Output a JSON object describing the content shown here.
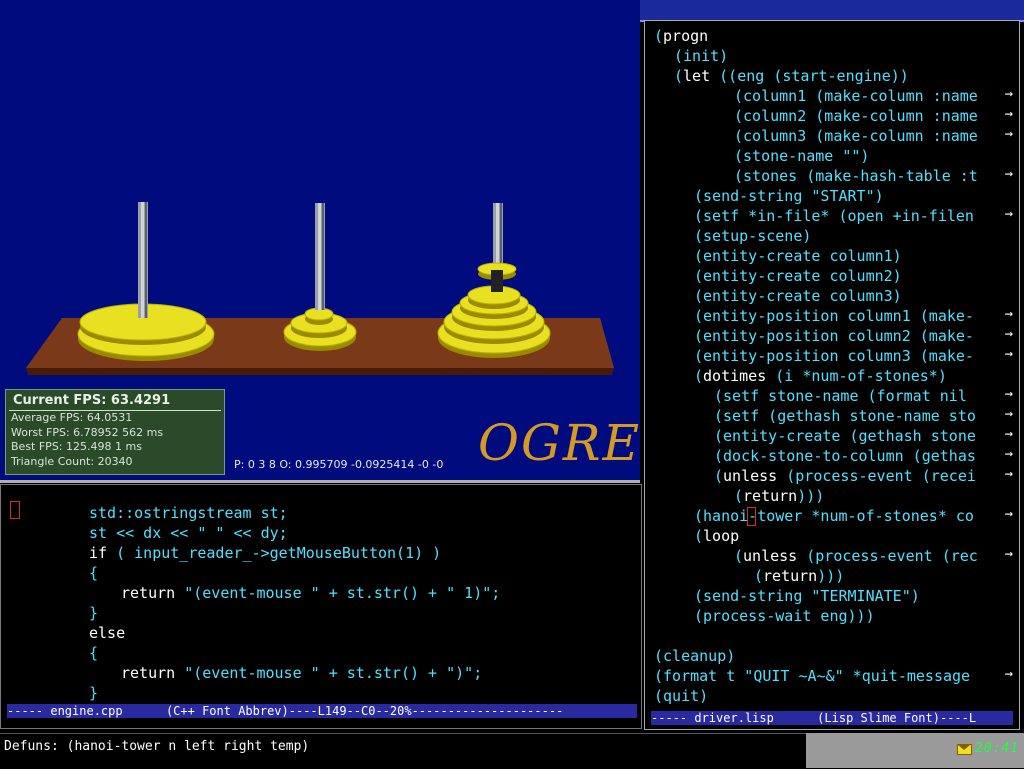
{
  "viewport": {
    "fps": {
      "current": "Current FPS: 63.4291",
      "average": "Average FPS: 64.0531",
      "worst": "Worst FPS: 6.78952 562 ms",
      "best": "Best FPS: 125.498 1 ms",
      "triangles": "Triangle Count: 20340"
    },
    "logo": "OGRE",
    "position_readout": "P: 0 3 8 O: 0.995709 -0.0925414 -0 -0",
    "colors": {
      "background": "#000c7e",
      "board": "#7a3a1a",
      "stone": "#e8e020",
      "peg": "#9aa0a6"
    }
  },
  "cpp_editor": {
    "lines": [
      {
        "indent": 5,
        "parts": [
          {
            "t": "std::ostringstream st;",
            "k": false
          }
        ]
      },
      {
        "indent": 5,
        "parts": [
          {
            "t": "st << dx << \" \" << dy;",
            "k": false
          }
        ]
      },
      {
        "indent": 5,
        "parts": [
          {
            "t": "if",
            "k": true
          },
          {
            "t": " ( input_reader_->getMouseButton(1) )",
            "k": false
          }
        ]
      },
      {
        "indent": 5,
        "parts": [
          {
            "t": "{",
            "k": false
          }
        ]
      },
      {
        "indent": 7,
        "parts": [
          {
            "t": "return",
            "k": true
          },
          {
            "t": " \"(event-mouse \" + st.str() + \" 1)\";",
            "k": false
          }
        ]
      },
      {
        "indent": 5,
        "parts": [
          {
            "t": "}",
            "k": false
          }
        ]
      },
      {
        "indent": 5,
        "parts": [
          {
            "t": "else",
            "k": true
          }
        ]
      },
      {
        "indent": 5,
        "parts": [
          {
            "t": "{",
            "k": false
          }
        ]
      },
      {
        "indent": 7,
        "parts": [
          {
            "t": "return",
            "k": true
          },
          {
            "t": " \"(event-mouse \" + st.str() + \")\";",
            "k": false
          }
        ]
      },
      {
        "indent": 5,
        "parts": [
          {
            "t": "}",
            "k": false
          }
        ]
      }
    ],
    "modeline": "----- engine.cpp      (C++ Font Abbrev)----L149--C0--20%---------------------"
  },
  "lisp_editor": {
    "lines": [
      {
        "indent": 0,
        "parts": [
          {
            "t": "(",
            "k": false
          },
          {
            "t": "progn",
            "k": true
          }
        ],
        "arrow": false
      },
      {
        "indent": 1,
        "parts": [
          {
            "t": "(init)",
            "k": false
          }
        ],
        "arrow": false
      },
      {
        "indent": 1,
        "parts": [
          {
            "t": "(",
            "k": false
          },
          {
            "t": "let",
            "k": true
          },
          {
            "t": " ((eng (start-engine))",
            "k": false
          }
        ],
        "arrow": false
      },
      {
        "indent": 4,
        "parts": [
          {
            "t": "(column1 (make-column :name",
            "k": false
          }
        ],
        "arrow": true
      },
      {
        "indent": 4,
        "parts": [
          {
            "t": "(column2 (make-column :name",
            "k": false
          }
        ],
        "arrow": true
      },
      {
        "indent": 4,
        "parts": [
          {
            "t": "(column3 (make-column :name",
            "k": false
          }
        ],
        "arrow": true
      },
      {
        "indent": 4,
        "parts": [
          {
            "t": "(stone-name \"\")",
            "k": false
          }
        ],
        "arrow": false
      },
      {
        "indent": 4,
        "parts": [
          {
            "t": "(stones (make-hash-table :t",
            "k": false
          }
        ],
        "arrow": true
      },
      {
        "indent": 2,
        "parts": [
          {
            "t": "(send-string \"START\")",
            "k": false
          }
        ],
        "arrow": false
      },
      {
        "indent": 2,
        "parts": [
          {
            "t": "(setf *in-file* (open +in-filen",
            "k": false
          }
        ],
        "arrow": true
      },
      {
        "indent": 2,
        "parts": [
          {
            "t": "(setup-scene)",
            "k": false
          }
        ],
        "arrow": false
      },
      {
        "indent": 2,
        "parts": [
          {
            "t": "(entity-create column1)",
            "k": false
          }
        ],
        "arrow": false
      },
      {
        "indent": 2,
        "parts": [
          {
            "t": "(entity-create column2)",
            "k": false
          }
        ],
        "arrow": false
      },
      {
        "indent": 2,
        "parts": [
          {
            "t": "(entity-create column3)",
            "k": false
          }
        ],
        "arrow": false
      },
      {
        "indent": 2,
        "parts": [
          {
            "t": "(entity-position column1 (make-",
            "k": false
          }
        ],
        "arrow": true
      },
      {
        "indent": 2,
        "parts": [
          {
            "t": "(entity-position column2 (make-",
            "k": false
          }
        ],
        "arrow": true
      },
      {
        "indent": 2,
        "parts": [
          {
            "t": "(entity-position column3 (make-",
            "k": false
          }
        ],
        "arrow": true
      },
      {
        "indent": 2,
        "parts": [
          {
            "t": "(",
            "k": false
          },
          {
            "t": "dotimes",
            "k": true
          },
          {
            "t": " (i *num-of-stones*)",
            "k": false
          }
        ],
        "arrow": false
      },
      {
        "indent": 3,
        "parts": [
          {
            "t": "(setf stone-name (format nil ",
            "k": false
          }
        ],
        "arrow": true
      },
      {
        "indent": 3,
        "parts": [
          {
            "t": "(setf (gethash stone-name sto",
            "k": false
          }
        ],
        "arrow": true
      },
      {
        "indent": 3,
        "parts": [
          {
            "t": "(entity-create (gethash stone",
            "k": false
          }
        ],
        "arrow": true
      },
      {
        "indent": 3,
        "parts": [
          {
            "t": "(dock-stone-to-column (gethas",
            "k": false
          }
        ],
        "arrow": true
      },
      {
        "indent": 3,
        "parts": [
          {
            "t": "(",
            "k": false
          },
          {
            "t": "unless",
            "k": true
          },
          {
            "t": " (process-event (recei",
            "k": false
          }
        ],
        "arrow": true
      },
      {
        "indent": 4,
        "parts": [
          {
            "t": "(",
            "k": false
          },
          {
            "t": "return",
            "k": true
          },
          {
            "t": ")))",
            "k": false
          }
        ],
        "arrow": false
      },
      {
        "indent": 2,
        "parts": [
          {
            "t": "(hanoi-tower *num-of-stones* co",
            "k": false
          }
        ],
        "arrow": true
      },
      {
        "indent": 2,
        "parts": [
          {
            "t": "(",
            "k": false
          },
          {
            "t": "loop",
            "k": true
          }
        ],
        "arrow": false
      },
      {
        "indent": 4,
        "parts": [
          {
            "t": "(",
            "k": false
          },
          {
            "t": "unless",
            "k": true
          },
          {
            "t": " (process-event (rec",
            "k": false
          }
        ],
        "arrow": true
      },
      {
        "indent": 5,
        "parts": [
          {
            "t": "(",
            "k": false
          },
          {
            "t": "return",
            "k": true
          },
          {
            "t": ")))",
            "k": false
          }
        ],
        "arrow": false
      },
      {
        "indent": 2,
        "parts": [
          {
            "t": "(send-string \"TERMINATE\")",
            "k": false
          }
        ],
        "arrow": false
      },
      {
        "indent": 2,
        "parts": [
          {
            "t": "(process-wait eng)))",
            "k": false
          }
        ],
        "arrow": false
      },
      {
        "indent": 0,
        "parts": [
          {
            "t": "",
            "k": false
          }
        ],
        "arrow": false
      },
      {
        "indent": 0,
        "parts": [
          {
            "t": "(cleanup)",
            "k": false
          }
        ],
        "arrow": false
      },
      {
        "indent": 0,
        "parts": [
          {
            "t": "(format t \"QUIT ~A~&\" *quit-message",
            "k": false
          }
        ],
        "arrow": true
      },
      {
        "indent": 0,
        "parts": [
          {
            "t": "(quit)",
            "k": false
          }
        ],
        "arrow": false
      }
    ],
    "modeline": "----- driver.lisp      (Lisp Slime Font)----L"
  },
  "minibuffer": {
    "text": "Defuns: (hanoi-tower n left right temp)"
  },
  "tray": {
    "clock": "20:41",
    "mail_icon": "mail-icon"
  }
}
